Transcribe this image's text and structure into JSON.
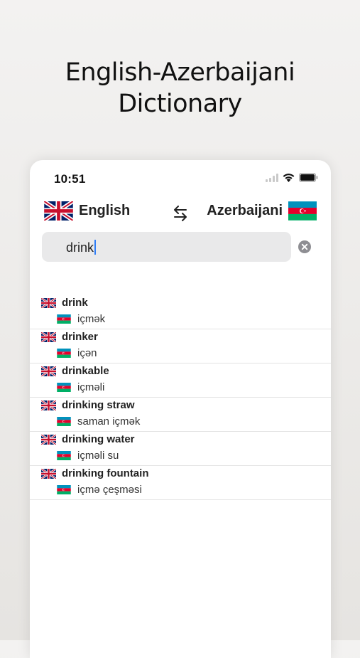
{
  "promo": {
    "title_line1": "English-Azerbaijani",
    "title_line2": "Dictionary"
  },
  "status_bar": {
    "time": "10:51"
  },
  "languages": {
    "source": "English",
    "target": "Azerbaijani"
  },
  "search": {
    "value": "drink"
  },
  "results": [
    {
      "en": "drink",
      "az": "içmək"
    },
    {
      "en": "drinker",
      "az": "içən"
    },
    {
      "en": "drinkable",
      "az": "içməli"
    },
    {
      "en": "drinking straw",
      "az": "saman içmək"
    },
    {
      "en": "drinking water",
      "az": "içməli su"
    },
    {
      "en": "drinking fountain",
      "az": "içmə çeşməsi"
    }
  ],
  "colors": {
    "uk_blue": "#012169",
    "uk_red": "#C8102E",
    "az_blue": "#0092BC",
    "az_red": "#E4002B",
    "az_green": "#00AF66",
    "caret": "#2f7df6"
  },
  "icons": [
    "signal-icon",
    "wifi-icon",
    "battery-icon",
    "swap-icon",
    "clear-icon",
    "uk-flag-icon",
    "azerbaijan-flag-icon"
  ]
}
